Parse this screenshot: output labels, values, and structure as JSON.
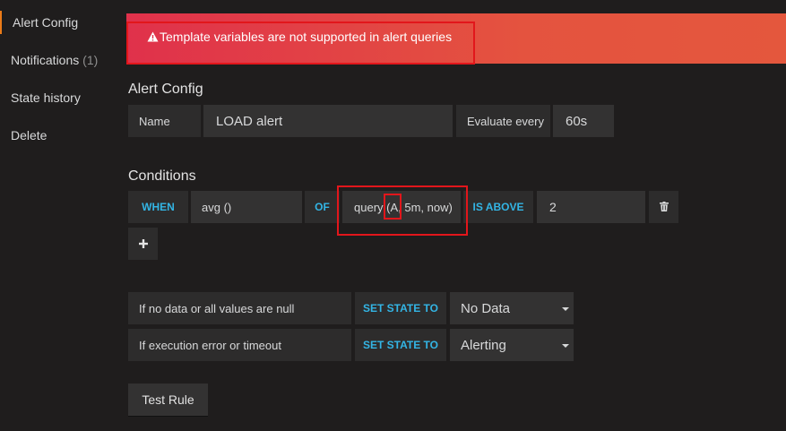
{
  "sidebar": {
    "items": [
      {
        "label": "Alert Config"
      },
      {
        "label": "Notifications",
        "count": "(1)"
      },
      {
        "label": "State history"
      },
      {
        "label": "Delete"
      }
    ]
  },
  "banner": {
    "message": "Template variables are not supported in alert queries",
    "icon": "warning-icon"
  },
  "alert_config": {
    "title": "Alert Config",
    "name_label": "Name",
    "name_value": "LOAD alert",
    "evaluate_label": "Evaluate every",
    "evaluate_value": "60s"
  },
  "conditions": {
    "title": "Conditions",
    "when_label": "WHEN",
    "reducer": "avg ()",
    "of_label": "OF",
    "query_prefix": "query (",
    "query_ref": "A",
    "query_suffix": ", 5m, now)",
    "evaluator_label": "IS ABOVE",
    "threshold": "2"
  },
  "handling": {
    "rows": [
      {
        "label": "If no data or all values are null",
        "action": "SET STATE TO",
        "value": "No Data"
      },
      {
        "label": "If execution error or timeout",
        "action": "SET STATE TO",
        "value": "Alerting"
      }
    ]
  },
  "test_rule_label": "Test Rule",
  "colors": {
    "background": "#1f1d1d",
    "accent_blue": "#33b5e5",
    "alert_red": "#e0314b",
    "active_orange": "#eb7b18",
    "highlight_box": "#e2161b"
  }
}
